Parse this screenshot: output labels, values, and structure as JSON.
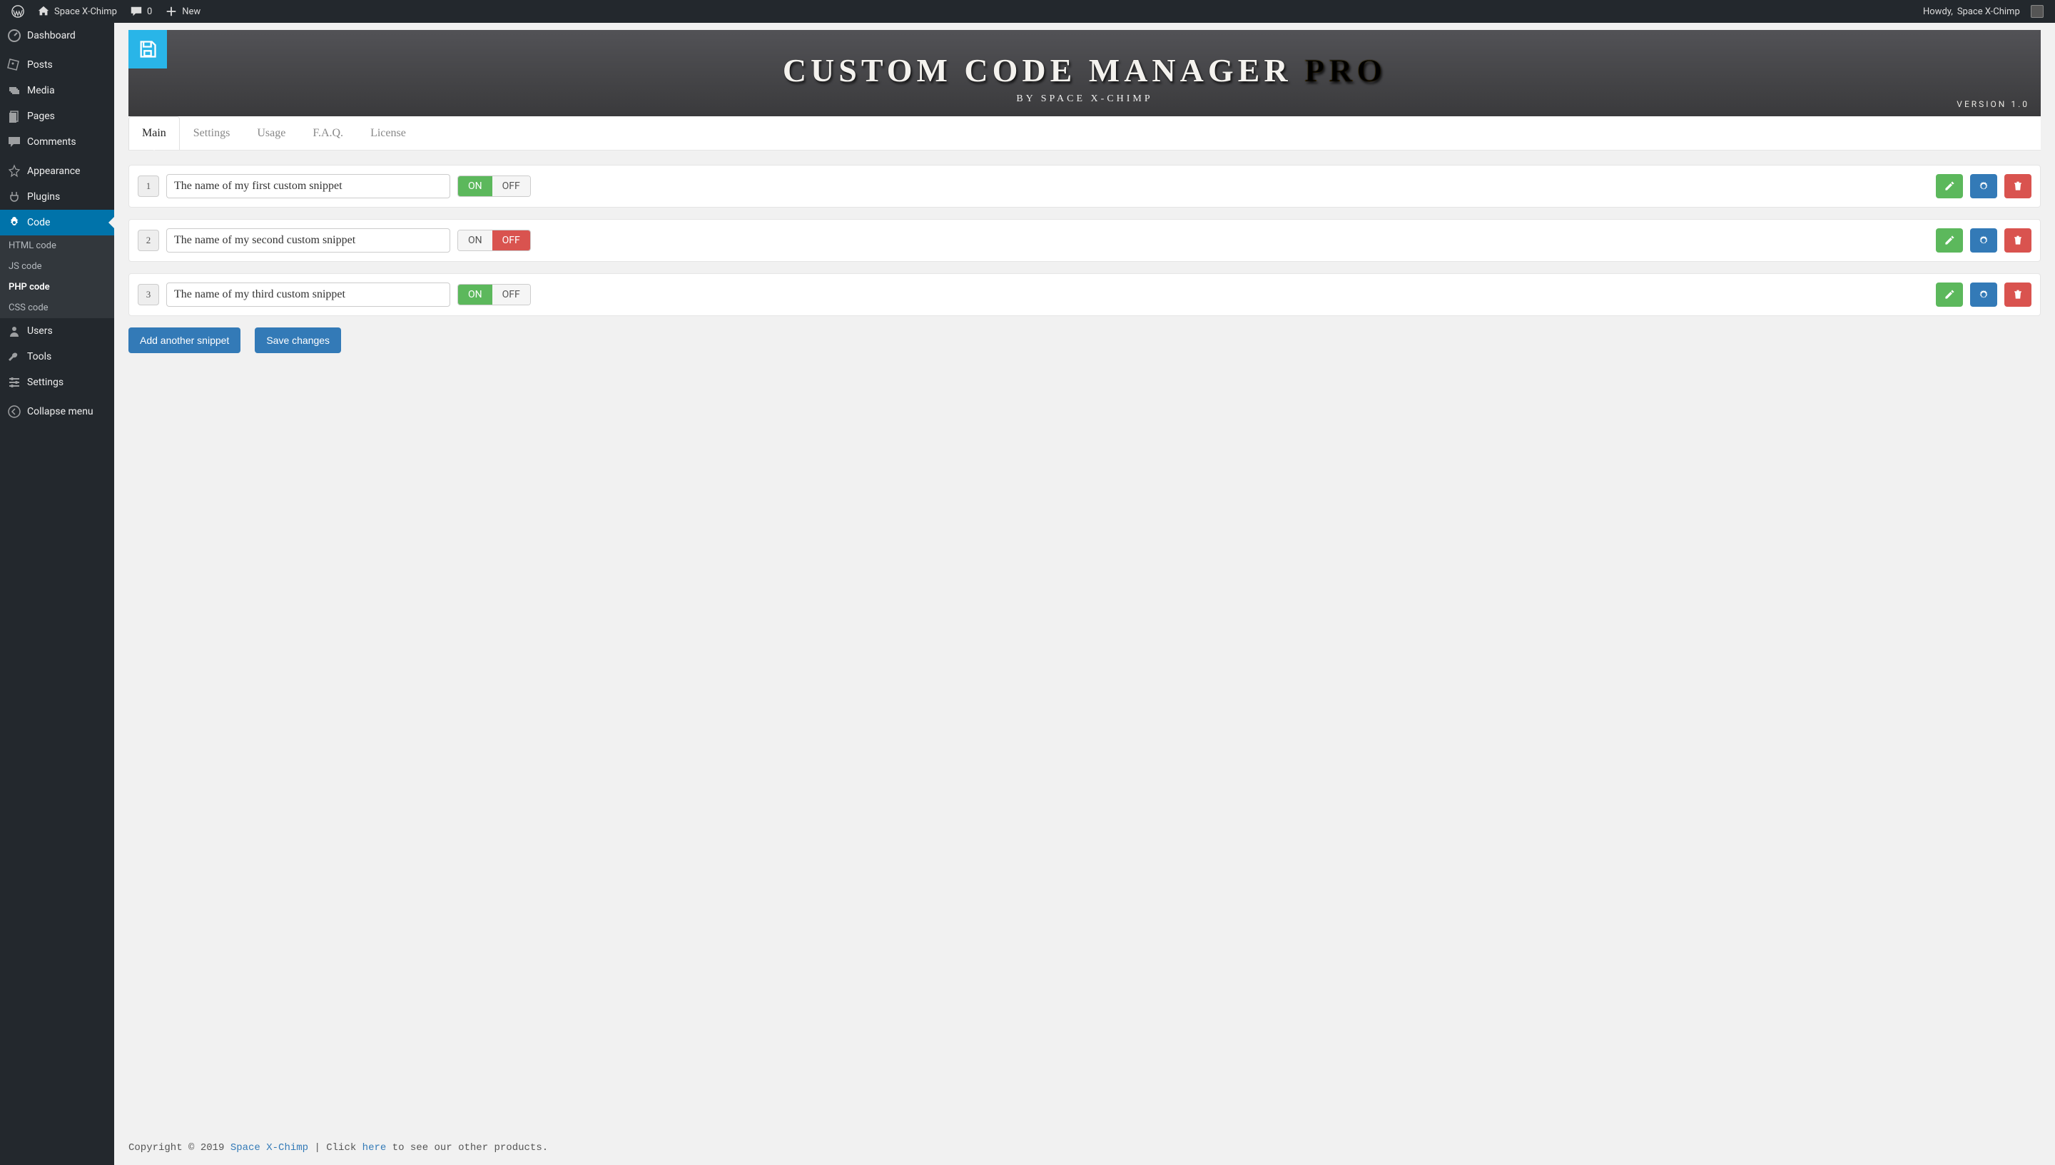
{
  "adminbar": {
    "site_name": "Space X-Chimp",
    "comments": "0",
    "new": "New",
    "howdy_prefix": "Howdy, ",
    "howdy_user": "Space X-Chimp"
  },
  "sidebar": {
    "items": [
      {
        "label": "Dashboard"
      },
      {
        "label": "Posts"
      },
      {
        "label": "Media"
      },
      {
        "label": "Pages"
      },
      {
        "label": "Comments"
      },
      {
        "label": "Appearance"
      },
      {
        "label": "Plugins"
      },
      {
        "label": "Code"
      },
      {
        "label": "Users"
      },
      {
        "label": "Tools"
      },
      {
        "label": "Settings"
      },
      {
        "label": "Collapse menu"
      }
    ],
    "submenu": [
      {
        "label": "HTML code"
      },
      {
        "label": "JS code"
      },
      {
        "label": "PHP code"
      },
      {
        "label": "CSS code"
      }
    ]
  },
  "hero": {
    "title_main": "CUSTOM CODE MANAGER",
    "title_pro": "PRO",
    "subtitle": "BY SPACE X-CHIMP",
    "version": "VERSION 1.0"
  },
  "tabs": [
    "Main",
    "Settings",
    "Usage",
    "F.A.Q.",
    "License"
  ],
  "snippets": [
    {
      "n": "1",
      "name": "The name of my first custom snippet",
      "state": "on"
    },
    {
      "n": "2",
      "name": "The name of my second custom snippet",
      "state": "off"
    },
    {
      "n": "3",
      "name": "The name of my third custom snippet",
      "state": "on"
    }
  ],
  "toggle": {
    "on": "ON",
    "off": "OFF"
  },
  "buttons": {
    "add": "Add another snippet",
    "save": "Save changes"
  },
  "footer": {
    "copy": "Copyright © 2019 ",
    "brand": "Space X-Chimp",
    "mid": " | Click ",
    "here": "here",
    "tail": " to see our other products."
  }
}
